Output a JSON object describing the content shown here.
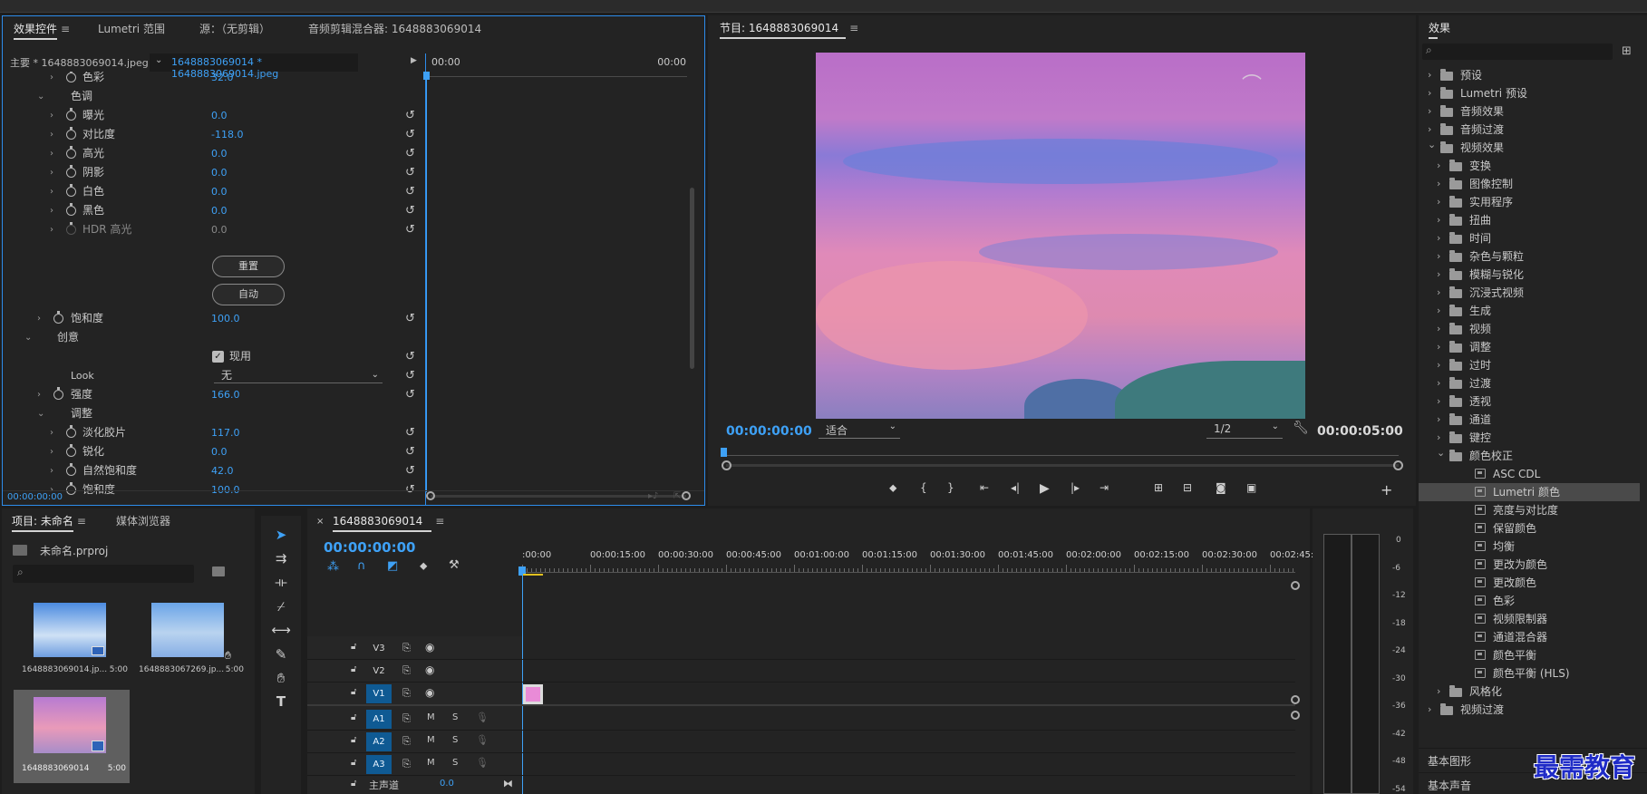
{
  "effect_controls": {
    "tabs": [
      "效果控件",
      "Lumetri 范围",
      "源：（无剪辑）",
      "音频剪辑混合器: 1648883069014"
    ],
    "master_clip": "主要 * 1648883069014.jpeg",
    "sequence_clip": "1648883069014 * 1648883069014.jpeg",
    "timecode_start": "00:00",
    "timecode_end": "00:00",
    "footer_timecode": "00:00:00:00",
    "rows": [
      {
        "label": "色彩",
        "value": "32.0"
      },
      {
        "label": "色调",
        "value": ""
      },
      {
        "label": "曝光",
        "value": "0.0"
      },
      {
        "label": "对比度",
        "value": "-118.0"
      },
      {
        "label": "高光",
        "value": "0.0"
      },
      {
        "label": "阴影",
        "value": "0.0"
      },
      {
        "label": "白色",
        "value": "0.0"
      },
      {
        "label": "黑色",
        "value": "0.0"
      },
      {
        "label": "HDR 高光",
        "value": "0.0"
      },
      {
        "label": "饱和度",
        "value": "100.0"
      },
      {
        "label": "创意",
        "value": ""
      },
      {
        "label": "Look",
        "value": "无"
      },
      {
        "label": "强度",
        "value": "166.0"
      },
      {
        "label": "调整",
        "value": ""
      },
      {
        "label": "淡化胶片",
        "value": "117.0"
      },
      {
        "label": "锐化",
        "value": "0.0"
      },
      {
        "label": "自然饱和度",
        "value": "42.0"
      },
      {
        "label": "饱和度",
        "value": "100.0"
      }
    ],
    "reset_button": "重置",
    "auto_button": "自动",
    "enable_checkbox": "现用"
  },
  "program": {
    "title": "节目: 1648883069014",
    "timecode_current": "00:00:00:00",
    "timecode_total": "00:00:05:00",
    "fit_select": "适合",
    "resolution_select": "1/2"
  },
  "project": {
    "tabs": [
      "项目: 未命名",
      "媒体浏览器"
    ],
    "file": "未命名.prproj",
    "items": [
      {
        "name": "1648883069014.jp...",
        "duration": "5:00"
      },
      {
        "name": "1648883067269.jp...",
        "duration": "5:00"
      },
      {
        "name": "1648883069014",
        "duration": "5:00"
      }
    ]
  },
  "timeline": {
    "tab": "1648883069014",
    "timecode": "00:00:00:00",
    "ruler": [
      ":00:00",
      "00:00:15:00",
      "00:00:30:00",
      "00:00:45:00",
      "00:01:00:00",
      "00:01:15:00",
      "00:01:30:00",
      "00:01:45:00",
      "00:02:00:00",
      "00:02:15:00",
      "00:02:30:00",
      "00:02:45:"
    ],
    "video_tracks": [
      "V3",
      "V2",
      "V1"
    ],
    "audio_tracks": [
      "A1",
      "A2",
      "A3"
    ],
    "master_label": "主声道",
    "master_value": "0.0",
    "mute": "M",
    "solo": "S"
  },
  "meter": {
    "scale": [
      "0",
      "-6",
      "-12",
      "-18",
      "-24",
      "-30",
      "-36",
      "-42",
      "-48",
      "-54"
    ]
  },
  "effects": {
    "title": "效果",
    "tree": [
      {
        "label": "预设",
        "level": 0,
        "kind": "bin",
        "open": false
      },
      {
        "label": "Lumetri 预设",
        "level": 0,
        "kind": "bin",
        "open": false
      },
      {
        "label": "音频效果",
        "level": 0,
        "kind": "folder",
        "open": false
      },
      {
        "label": "音频过渡",
        "level": 0,
        "kind": "folder",
        "open": false
      },
      {
        "label": "视频效果",
        "level": 0,
        "kind": "folder",
        "open": true
      },
      {
        "label": "变换",
        "level": 1,
        "kind": "folder",
        "open": false
      },
      {
        "label": "图像控制",
        "level": 1,
        "kind": "folder",
        "open": false
      },
      {
        "label": "实用程序",
        "level": 1,
        "kind": "folder",
        "open": false
      },
      {
        "label": "扭曲",
        "level": 1,
        "kind": "folder",
        "open": false
      },
      {
        "label": "时间",
        "level": 1,
        "kind": "folder",
        "open": false
      },
      {
        "label": "杂色与颗粒",
        "level": 1,
        "kind": "folder",
        "open": false
      },
      {
        "label": "模糊与锐化",
        "level": 1,
        "kind": "folder",
        "open": false
      },
      {
        "label": "沉浸式视频",
        "level": 1,
        "kind": "folder",
        "open": false
      },
      {
        "label": "生成",
        "level": 1,
        "kind": "folder",
        "open": false
      },
      {
        "label": "视频",
        "level": 1,
        "kind": "folder",
        "open": false
      },
      {
        "label": "调整",
        "level": 1,
        "kind": "folder",
        "open": false
      },
      {
        "label": "过时",
        "level": 1,
        "kind": "folder",
        "open": false
      },
      {
        "label": "过渡",
        "level": 1,
        "kind": "folder",
        "open": false
      },
      {
        "label": "透视",
        "level": 1,
        "kind": "folder",
        "open": false
      },
      {
        "label": "通道",
        "level": 1,
        "kind": "folder",
        "open": false
      },
      {
        "label": "键控",
        "level": 1,
        "kind": "folder",
        "open": false
      },
      {
        "label": "颜色校正",
        "level": 1,
        "kind": "folder",
        "open": true
      },
      {
        "label": "ASC CDL",
        "level": 2,
        "kind": "fx",
        "open": false
      },
      {
        "label": "Lumetri 颜色",
        "level": 2,
        "kind": "fx",
        "open": false,
        "selected": true
      },
      {
        "label": "亮度与对比度",
        "level": 2,
        "kind": "fx",
        "open": false
      },
      {
        "label": "保留颜色",
        "level": 2,
        "kind": "fx",
        "open": false
      },
      {
        "label": "均衡",
        "level": 2,
        "kind": "fx",
        "open": false
      },
      {
        "label": "更改为颜色",
        "level": 2,
        "kind": "fx",
        "open": false
      },
      {
        "label": "更改颜色",
        "level": 2,
        "kind": "fx",
        "open": false
      },
      {
        "label": "色彩",
        "level": 2,
        "kind": "fx",
        "open": false
      },
      {
        "label": "视频限制器",
        "level": 2,
        "kind": "fx",
        "open": false
      },
      {
        "label": "通道混合器",
        "level": 2,
        "kind": "fx",
        "open": false
      },
      {
        "label": "颜色平衡",
        "level": 2,
        "kind": "fx",
        "open": false
      },
      {
        "label": "颜色平衡 (HLS)",
        "level": 2,
        "kind": "fx",
        "open": false
      },
      {
        "label": "风格化",
        "level": 1,
        "kind": "folder",
        "open": false
      },
      {
        "label": "视频过渡",
        "level": 0,
        "kind": "folder",
        "open": false
      }
    ],
    "basic_graphics": "基本图形",
    "basic_sound": "基本声音"
  },
  "watermark": "最需教育",
  "colors": {
    "accent": "#3ea1f6",
    "track_on": "#0f5a93",
    "clip": "#e98bd7",
    "panel": "#232323"
  }
}
